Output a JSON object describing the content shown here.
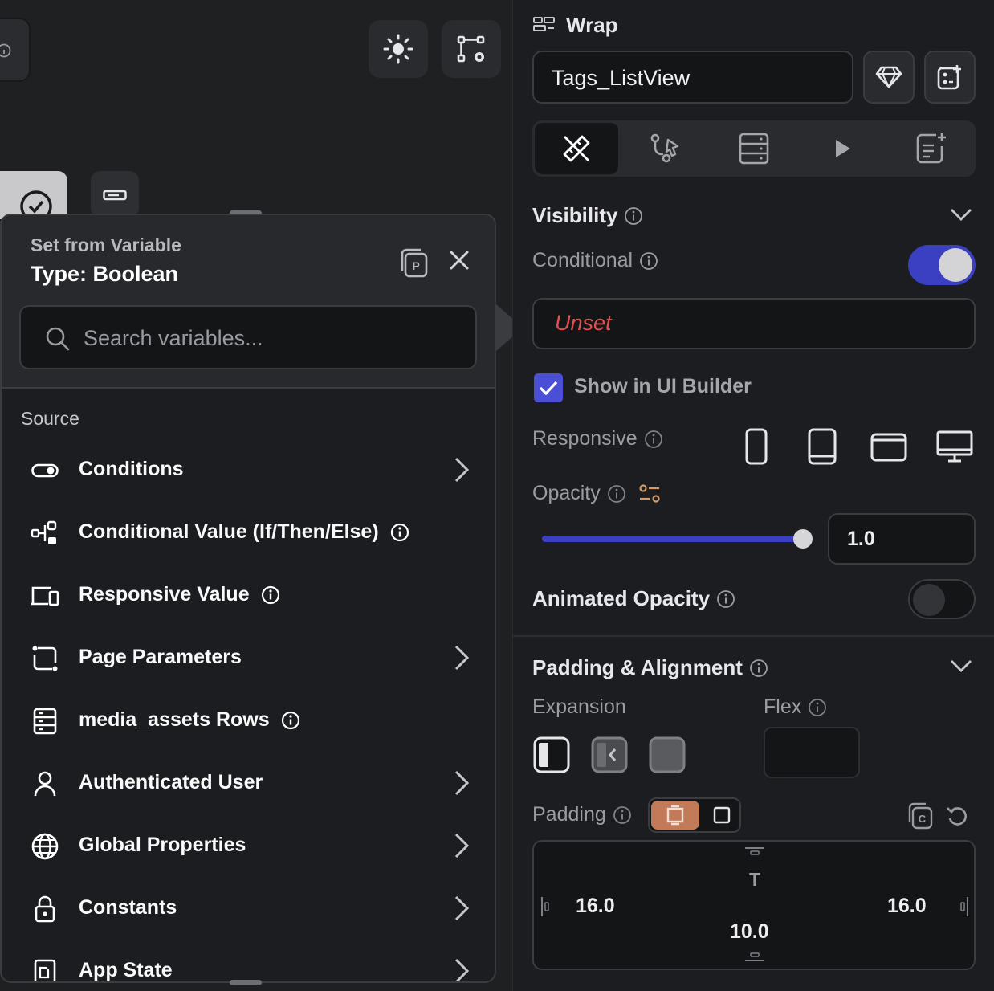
{
  "popover": {
    "subtitle": "Set from Variable",
    "title": "Type: Boolean",
    "search_placeholder": "Search variables...",
    "source_label": "Source",
    "items": [
      {
        "label": "Conditions",
        "icon": "toggle-icon",
        "has_chevron": true,
        "has_info": false
      },
      {
        "label": "Conditional Value (If/Then/Else)",
        "icon": "flow-branch-icon",
        "has_chevron": false,
        "has_info": true
      },
      {
        "label": "Responsive Value",
        "icon": "devices-icon",
        "has_chevron": false,
        "has_info": true
      },
      {
        "label": "Page Parameters",
        "icon": "page-params-icon",
        "has_chevron": true,
        "has_info": false
      },
      {
        "label": "media_assets Rows",
        "icon": "table-rows-icon",
        "has_chevron": false,
        "has_info": true
      },
      {
        "label": "Authenticated User",
        "icon": "user-icon",
        "has_chevron": true,
        "has_info": false
      },
      {
        "label": "Global Properties",
        "icon": "globe-icon",
        "has_chevron": true,
        "has_info": false
      },
      {
        "label": "Constants",
        "icon": "lock-icon",
        "has_chevron": true,
        "has_info": false
      },
      {
        "label": "App State",
        "icon": "app-state-icon",
        "has_chevron": true,
        "has_info": false
      }
    ]
  },
  "panel": {
    "widget_type": "Wrap",
    "widget_name": "Tags_ListView",
    "visibility": {
      "title": "Visibility",
      "conditional_label": "Conditional",
      "conditional_on": true,
      "condition_value": "Unset",
      "show_in_builder_label": "Show in UI Builder",
      "show_in_builder_checked": true,
      "responsive_label": "Responsive",
      "opacity_label": "Opacity",
      "opacity_value": "1.0",
      "opacity_fraction": 1.0,
      "animated_opacity_label": "Animated Opacity",
      "animated_opacity_on": false
    },
    "padding_alignment": {
      "title": "Padding & Alignment",
      "expansion_label": "Expansion",
      "flex_label": "Flex",
      "flex_value": "",
      "padding_label": "Padding",
      "padding_left": "16.0",
      "padding_right": "16.0",
      "padding_bottom": "10.0",
      "padding_top_label": "T"
    }
  },
  "colors": {
    "accent": "#3b3fc2",
    "danger_text": "#e05050",
    "padding_toggle": "#c27a59"
  }
}
